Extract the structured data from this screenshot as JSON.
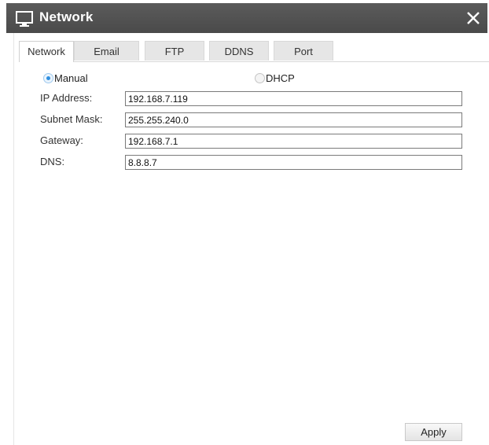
{
  "window": {
    "title": "Network",
    "icon": "network-monitor-icon",
    "close_icon": "close-icon"
  },
  "tabs": [
    {
      "label": "Network",
      "active": true
    },
    {
      "label": "Email",
      "active": false
    },
    {
      "label": "FTP",
      "active": false
    },
    {
      "label": "DDNS",
      "active": false
    },
    {
      "label": "Port",
      "active": false
    }
  ],
  "mode": {
    "manual_label": "Manual",
    "dhcp_label": "DHCP",
    "selected": "Manual"
  },
  "fields": {
    "ip_address": {
      "label": "IP Address:",
      "value": "192.168.7.119"
    },
    "subnet_mask": {
      "label": "Subnet Mask:",
      "value": "255.255.240.0"
    },
    "gateway": {
      "label": "Gateway:",
      "value": "192.168.7.1"
    },
    "dns": {
      "label": "DNS:",
      "value": "8.8.8.7"
    }
  },
  "apply_label": "Apply",
  "colors": {
    "titlebar": "#4f4f4f",
    "radio_selected": "#2f8fe0"
  }
}
